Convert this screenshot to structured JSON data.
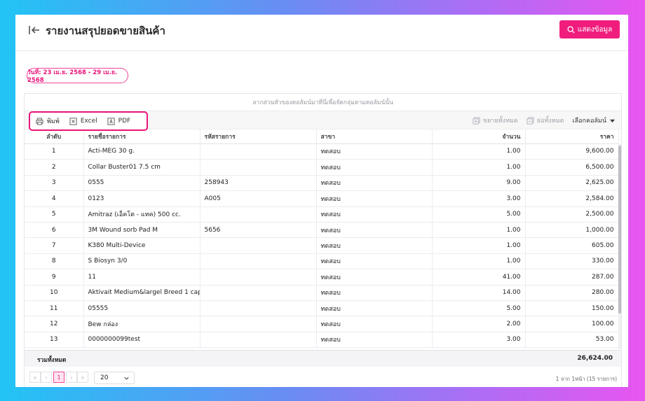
{
  "header": {
    "title": "รายงานสรุปยอดขายสินค้า",
    "show_button": "แสดงข้อมูล"
  },
  "filter": {
    "date_range": "วันที่: 23 เม.ย. 2568 - 29 เม.ย. 2568"
  },
  "grid": {
    "group_hint": "ลากส่วนหัวของคอลัมน์มาที่นี่เพื่อจัดกลุ่มตามคอลัมน์นั้น",
    "toolbar": {
      "print": "พิมพ์",
      "excel": "Excel",
      "pdf": "PDF",
      "expand_all": "ขยายทั้งหมด",
      "collapse_all": "ย่อทั้งหมด",
      "choose_columns": "เลือกคอลัมน์"
    },
    "columns": [
      "ลำดับ",
      "รายชื่อรายการ",
      "รหัสรายการ",
      "สาขา",
      "จำนวน",
      "ราคา"
    ],
    "rows": [
      [
        "1",
        "Acti-MEG 30 g.",
        "",
        "ทดสอบ",
        "1.00",
        "9,600.00"
      ],
      [
        "2",
        "Collar Buster01 7.5 cm",
        "",
        "ทดสอบ",
        "1.00",
        "6,500.00"
      ],
      [
        "3",
        "0555",
        "258943",
        "ทดสอบ",
        "9.00",
        "2,625.00"
      ],
      [
        "4",
        "0123",
        "A005",
        "ทดสอบ",
        "3.00",
        "2,584.00"
      ],
      [
        "5",
        "Amitraz (เอ็คโต - แทค) 500 cc.",
        "",
        "ทดสอบ",
        "5.00",
        "2,500.00"
      ],
      [
        "6",
        "3M Wound sorb Pad M",
        "5656",
        "ทดสอบ",
        "1.00",
        "1,000.00"
      ],
      [
        "7",
        "K380 Multi-Device",
        "",
        "ทดสอบ",
        "1.00",
        "605.00"
      ],
      [
        "8",
        "S Biosyn 3/0",
        "",
        "ทดสอบ",
        "1.00",
        "330.00"
      ],
      [
        "9",
        "11",
        "",
        "ทดสอบ",
        "41.00",
        "287.00"
      ],
      [
        "10",
        "Aktivait Medium&largel Breed 1 cap",
        "",
        "ทดสอบ",
        "14.00",
        "280.00"
      ],
      [
        "11",
        "05555",
        "",
        "ทดสอบ",
        "5.00",
        "150.00"
      ],
      [
        "12",
        "Bew กล่อง",
        "",
        "ทดสอบ",
        "2.00",
        "100.00"
      ],
      [
        "13",
        "0000000099test",
        "",
        "ทดสอบ",
        "3.00",
        "53.00"
      ]
    ],
    "summary_label": "รวมทั้งหมด",
    "summary_total": "26,624.00"
  },
  "pager": {
    "first": "«",
    "prev": "‹",
    "current": "1",
    "next": "›",
    "last": "»",
    "page_size": "20",
    "info": "1 จาก 1หน้า (15 รายการ)"
  },
  "colors": {
    "accent": "#f01d7e"
  }
}
